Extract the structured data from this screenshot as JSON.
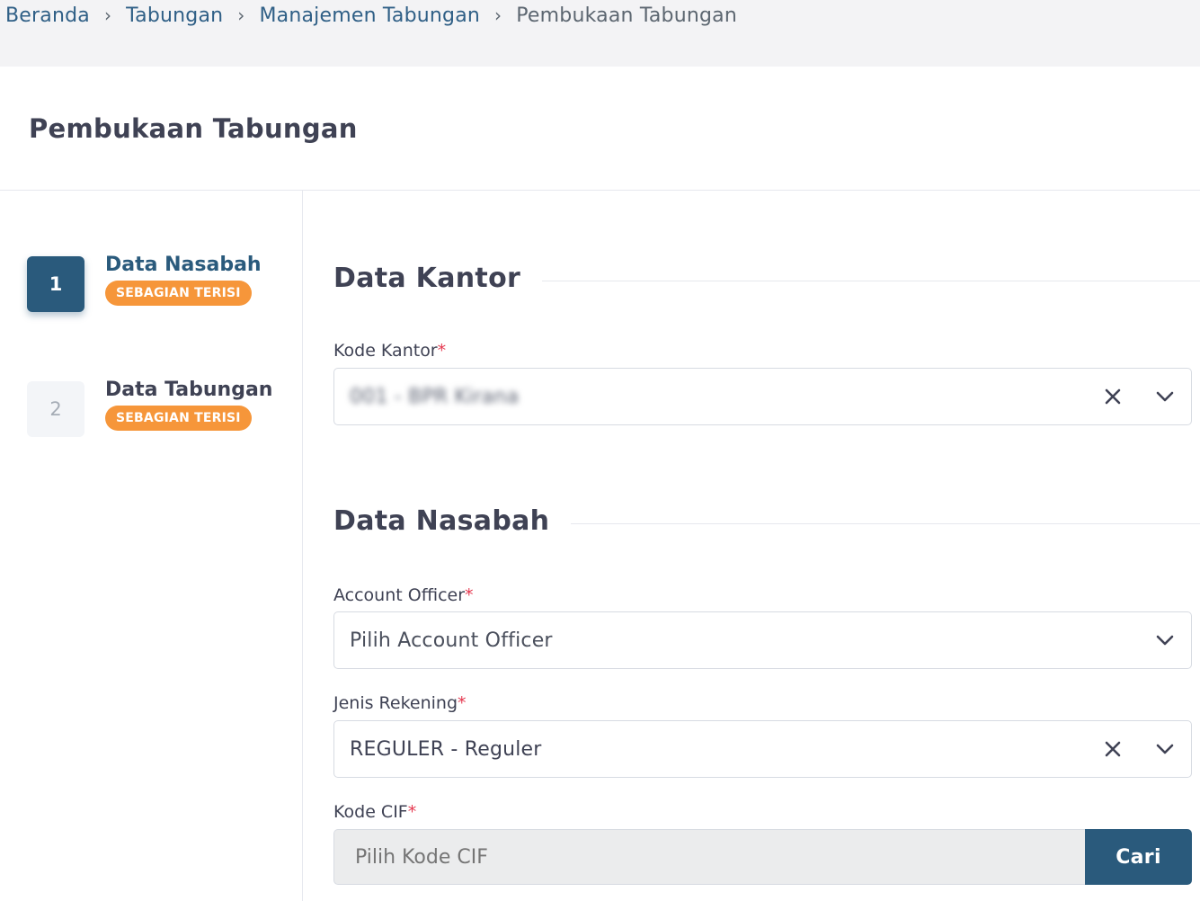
{
  "breadcrumb": {
    "items": [
      "Beranda",
      "Tabungan",
      "Manajemen Tabungan"
    ],
    "current": "Pembukaan Tabungan",
    "separator": "›"
  },
  "page": {
    "title": "Pembukaan Tabungan"
  },
  "steps": [
    {
      "number": "1",
      "title": "Data Nasabah",
      "badge": "SEBAGIAN TERISI",
      "active": true
    },
    {
      "number": "2",
      "title": "Data Tabungan",
      "badge": "SEBAGIAN TERISI",
      "active": false
    }
  ],
  "sections": {
    "kantor": {
      "title": "Data Kantor",
      "kode_kantor": {
        "label": "Kode Kantor",
        "required_mark": "*",
        "value": "001 - BPR Kirana",
        "value_obscured": true
      }
    },
    "nasabah": {
      "title": "Data Nasabah",
      "account_officer": {
        "label": "Account Officer",
        "required_mark": "*",
        "placeholder": "Pilih Account Officer"
      },
      "jenis_rekening": {
        "label": "Jenis Rekening",
        "required_mark": "*",
        "value": "REGULER - Reguler"
      },
      "kode_cif": {
        "label": "Kode CIF",
        "required_mark": "*",
        "placeholder": "Pilih Kode CIF",
        "button_label": "Cari"
      }
    }
  },
  "colors": {
    "primary": "#2a5a7c",
    "badge": "#f6963a",
    "required": "#e53950",
    "link": "#2f5f86"
  },
  "icons": {
    "clear": "close-icon",
    "dropdown": "chevron-down-icon",
    "separator": "chevron-right-icon"
  }
}
